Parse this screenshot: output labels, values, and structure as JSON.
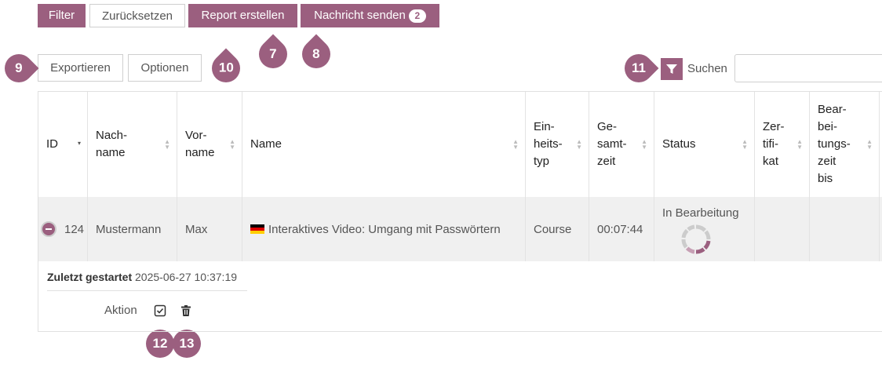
{
  "toolbar": {
    "filter": "Filter",
    "reset": "Zurücksetzen",
    "report": "Report erstellen",
    "message": "Nachricht senden",
    "message_count": "2",
    "export": "Exportieren",
    "options": "Optionen",
    "search_label": "Suchen"
  },
  "markers": {
    "m7": "7",
    "m8": "8",
    "m9": "9",
    "m10": "10",
    "m11": "11",
    "m12": "12",
    "m13": "13"
  },
  "columns": {
    "id": "ID",
    "nachname": "Nach-\nname",
    "vorname": "Vor-\nname",
    "name": "Name",
    "einheitstyp": "Ein-\nheits-\ntyp",
    "gesamtzeit": "Ge-\nsamt-\nzeit",
    "status": "Status",
    "zertifikat": "Zer-\ntifi-\nkat",
    "bearbeitungszeit": "Bear-\nbei-\ntungs-\nzeit\nbis"
  },
  "row": {
    "id": "124",
    "nachname": "Mustermann",
    "vorname": "Max",
    "name": "Interaktives Video: Umgang mit Passwörtern",
    "einheitstyp": "Course",
    "gesamtzeit": "00:07:44",
    "status": "In Bearbeitung",
    "zertifikat": "",
    "bearbeitungszeit": ""
  },
  "detail": {
    "label": "Zuletzt gestartet",
    "value": "2025-06-27 10:37:19",
    "action_label": "Aktion"
  },
  "colors": {
    "accent": "#9b5f7f"
  }
}
